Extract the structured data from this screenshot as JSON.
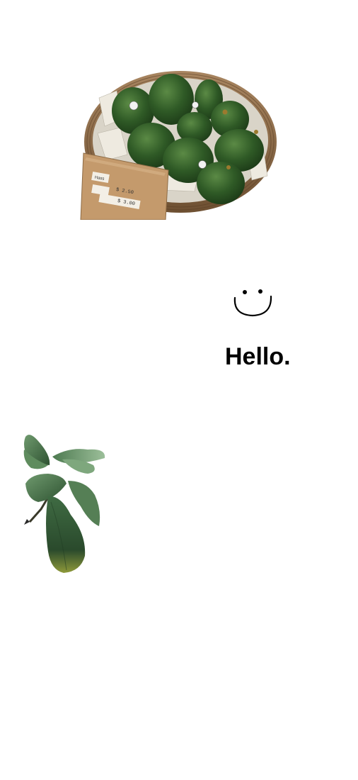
{
  "canvas": {
    "background": "#ffffff"
  },
  "avocado_basket": {
    "description_icon": "avocado-basket-photo",
    "price_card": {
      "line1": "Hass",
      "line2": "$ 2.50",
      "line3": "$ 3.00"
    },
    "colors": {
      "avocado": "#2f5a26",
      "avocado_highlight": "#4f7d3a",
      "basket": "#8a6a45",
      "card": "#c49a6c"
    }
  },
  "smiley": {
    "icon": "smiley-face-icon",
    "color": "#000000"
  },
  "greeting": {
    "text": "Hello."
  },
  "plant": {
    "icon": "fiddle-leaf-plant-photo",
    "colors": {
      "leaf_dark": "#2e5231",
      "leaf_light": "#6f9a6e",
      "leaf_yellow": "#8f9a3a"
    }
  }
}
